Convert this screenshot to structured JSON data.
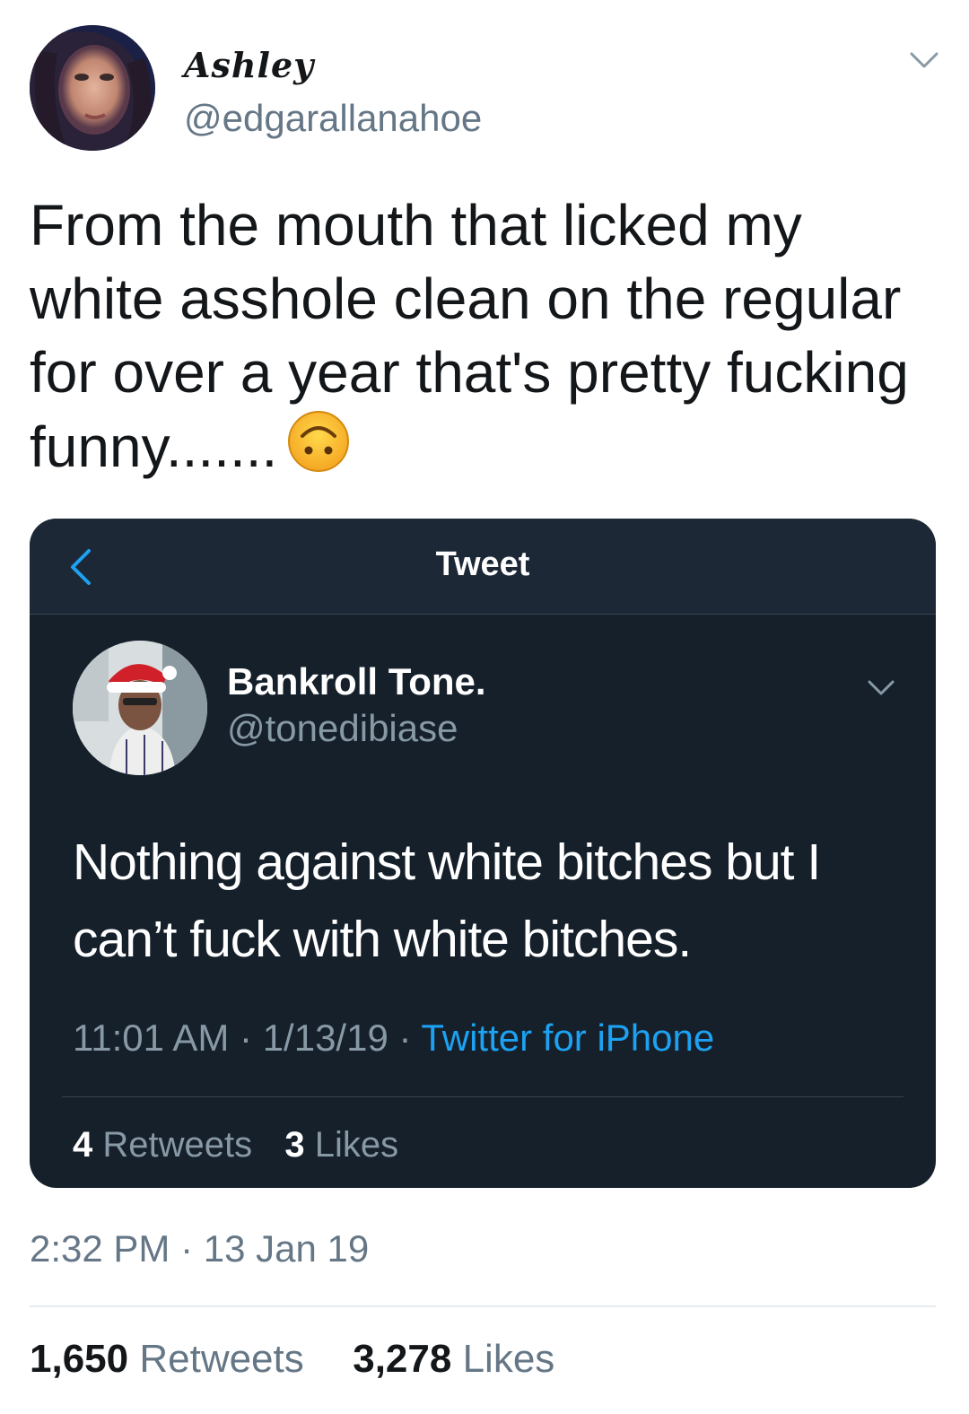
{
  "tweet": {
    "author": {
      "display_name": "Ashley",
      "handle": "@edgarallanahoe"
    },
    "text": "From the mouth that licked my white asshole clean on the regular for over a year that's pretty fucking funny.......",
    "emoji": "upside-down-face-emoji",
    "timestamp": "2:32 PM · 13 Jan 19",
    "stats": {
      "retweets_count": "1,650",
      "retweets_label": "Retweets",
      "likes_count": "3,278",
      "likes_label": "Likes"
    }
  },
  "quoted_screenshot": {
    "header_title": "Tweet",
    "author": {
      "display_name": "Bankroll Tone.",
      "handle": "@tonedibiase"
    },
    "text": "Nothing against white bitches but I can’t fuck with white bitches.",
    "time": "11:01 AM",
    "date": "1/13/19",
    "separator": "·",
    "source": "Twitter for iPhone",
    "stats": {
      "retweets_count": "4",
      "retweets_label": "Retweets",
      "likes_count": "3",
      "likes_label": "Likes"
    }
  },
  "colors": {
    "accent": "#1da1f2",
    "dark_card_bg": "#15202b",
    "secondary_text": "#657786"
  }
}
